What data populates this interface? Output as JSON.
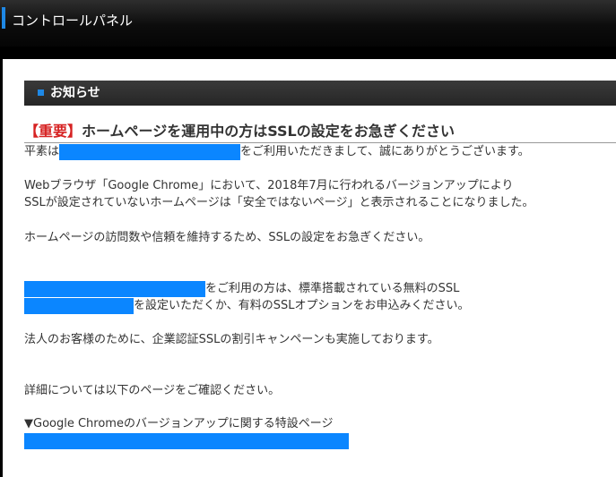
{
  "header": {
    "title": "コントロールパネル",
    "accent_color": "#1e88e5"
  },
  "section": {
    "title": "お知らせ"
  },
  "notice": {
    "headline_tag": "【重要】",
    "headline": "ホームページを運用中の方はSSLの設定をお急ぎください",
    "line1_prefix": "平素は",
    "line1_suffix": "をご利用いただきまして、誠にありがとうございます。",
    "line2": "Webブラウザ「Google Chrome」において、2018年7月に行われるバージョンアップにより",
    "line3": "SSLが設定されていないホームページは「安全ではないページ」と表示されることになりました。",
    "line4": "ホームページの訪問数や信頼を維持するため、SSLの設定をお急ぎください。",
    "line5_suffix": "をご利用の方は、標準搭載されている無料のSSL",
    "line6_suffix": "を設定いただくか、有料のSSLオプションをお申込みください。",
    "line7": "法人のお客様のために、企業認証SSLの割引キャンペーンも実施しております。",
    "line8": "詳細については以下のページをご確認ください。",
    "line9": "▼Google Chromeのバージョンアップに関する特設ページ",
    "redaction_color": "#0b86ff",
    "tag_color": "#d62222"
  }
}
